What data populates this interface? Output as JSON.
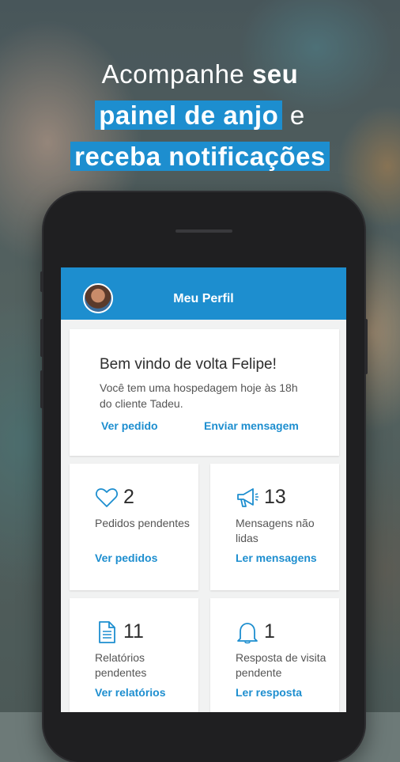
{
  "headline": {
    "line1_light": "Acompanhe ",
    "line1_bold": "seu",
    "line2_highlight": "painel de anjo",
    "line2_tail": " e",
    "line3_highlight": "receba notificações"
  },
  "header": {
    "title": "Meu Perfil"
  },
  "welcome": {
    "title": "Bem vindo de volta Felipe!",
    "message": "Você tem uma hospedagem hoje às 18h do cliente Tadeu.",
    "link_order": "Ver pedido",
    "link_message": "Enviar mensagem"
  },
  "stats": [
    {
      "icon": "heart-icon",
      "count": "2",
      "label": "Pedidos pendentes",
      "link": "Ver pedidos"
    },
    {
      "icon": "megaphone-icon",
      "count": "13",
      "label": "Mensagens não lidas",
      "link": "Ler mensagens"
    },
    {
      "icon": "document-icon",
      "count": "11",
      "label": "Relatórios pendentes",
      "link": "Ver relatórios"
    },
    {
      "icon": "bell-icon",
      "count": "1",
      "label": "Resposta de visita pendente",
      "link": "Ler resposta"
    }
  ],
  "colors": {
    "accent": "#1d8ecf",
    "card_bg": "#ffffff",
    "screen_bg": "#f1f2f2"
  }
}
